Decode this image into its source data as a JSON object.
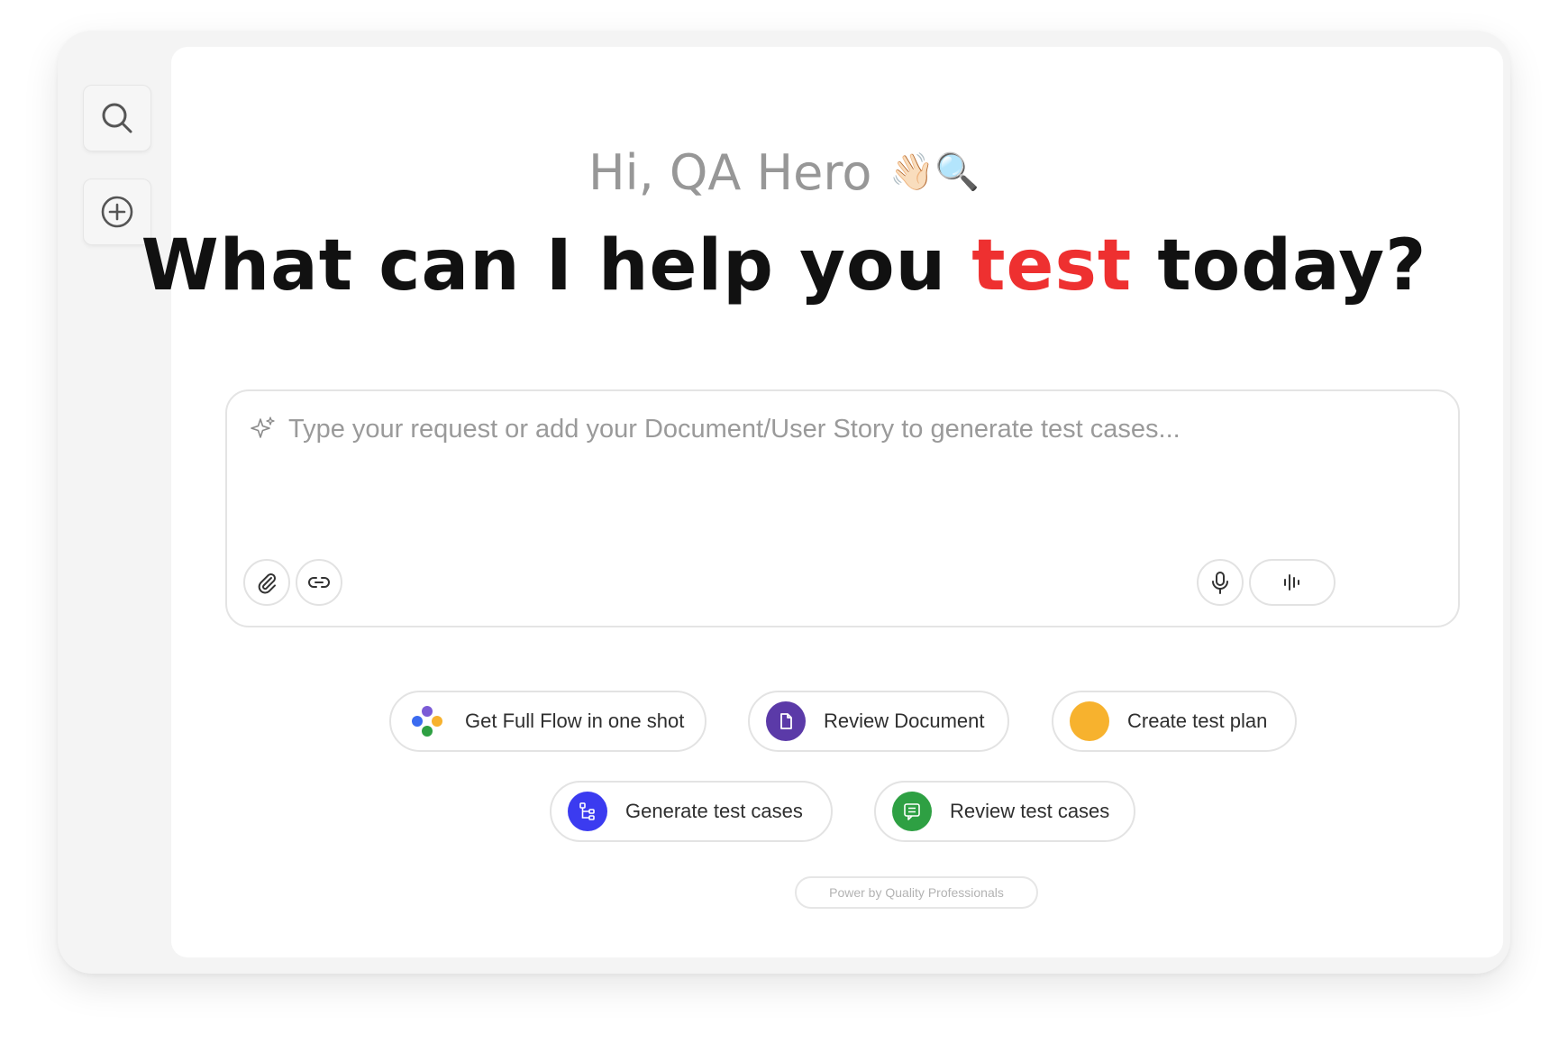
{
  "greeting": {
    "text": "Hi, QA Hero",
    "emoji": "👋🏻🔍"
  },
  "headline": {
    "before": "What can I help you ",
    "accent": "test",
    "after": " today?"
  },
  "prompt": {
    "placeholder": "Type your request or add your Document/User Story to generate test cases..."
  },
  "sidebar": {
    "buttons": [
      {
        "name": "search",
        "icon": "search-icon"
      },
      {
        "name": "new-chat",
        "icon": "plus-circle-icon"
      }
    ]
  },
  "toolbar": {
    "left": [
      {
        "name": "attach",
        "icon": "paperclip-icon"
      },
      {
        "name": "link",
        "icon": "link-icon"
      }
    ],
    "right": [
      {
        "name": "microphone",
        "icon": "microphone-icon"
      },
      {
        "name": "voice-mode",
        "icon": "waveform-icon"
      }
    ]
  },
  "chips": [
    {
      "label": "Get Full Flow in one shot",
      "icon": "multi-dot-flow-icon",
      "color": "#7b5bd6"
    },
    {
      "label": "Review Document",
      "icon": "document-icon",
      "color": "#5b3aa8"
    },
    {
      "label": "Create test plan",
      "icon": "orange-dot-icon",
      "color": "#f7b22e"
    },
    {
      "label": "Generate test cases",
      "icon": "tree-structure-icon",
      "color": "#3b3bf0"
    },
    {
      "label": "Review test cases",
      "icon": "chat-lines-icon",
      "color": "#2ea043"
    }
  ],
  "footer": {
    "text": "Power by Quality Professionals"
  },
  "colors": {
    "accent": "#ee3030",
    "frame": "#f4f4f4",
    "panel": "#ffffff"
  }
}
